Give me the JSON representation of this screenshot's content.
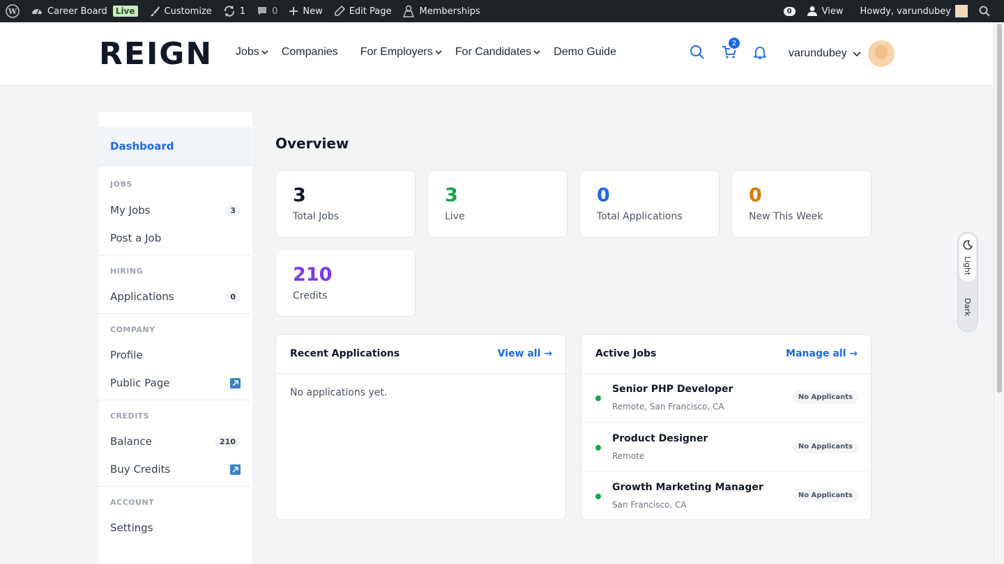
{
  "admin_bar": {
    "site_name": "Career Board",
    "live_badge": "Live",
    "customize": "Customize",
    "updates_count": "1",
    "comments_count": "0",
    "new": "New",
    "edit_page": "Edit Page",
    "memberships": "Memberships",
    "notifications_count": "0",
    "view": "View",
    "howdy": "Howdy, varundubey"
  },
  "header": {
    "logo": "REIGN",
    "nav": [
      {
        "label": "Jobs",
        "has_dropdown": true
      },
      {
        "label": "Companies",
        "has_dropdown": false
      },
      {
        "label": "For Employers",
        "has_dropdown": true
      },
      {
        "label": "For Candidates",
        "has_dropdown": true
      },
      {
        "label": "Demo Guide",
        "has_dropdown": false
      }
    ],
    "cart_count": "2",
    "username": "varundubey"
  },
  "sidebar": {
    "dashboard": "Dashboard",
    "sections": [
      {
        "heading": "JOBS",
        "items": [
          {
            "label": "My Jobs",
            "count": "3"
          },
          {
            "label": "Post a Job"
          }
        ]
      },
      {
        "heading": "HIRING",
        "items": [
          {
            "label": "Applications",
            "count": "0"
          }
        ]
      },
      {
        "heading": "COMPANY",
        "items": [
          {
            "label": "Profile"
          },
          {
            "label": "Public Page",
            "external": true
          }
        ]
      },
      {
        "heading": "CREDITS",
        "items": [
          {
            "label": "Balance",
            "count": "210"
          },
          {
            "label": "Buy Credits",
            "external": true
          }
        ]
      },
      {
        "heading": "ACCOUNT",
        "items": [
          {
            "label": "Settings"
          }
        ]
      }
    ]
  },
  "main": {
    "title": "Overview",
    "stats": [
      {
        "value": "3",
        "label": "Total Jobs",
        "color": "#111827"
      },
      {
        "value": "3",
        "label": "Live",
        "color": "#16a34a"
      },
      {
        "value": "0",
        "label": "Total Applications",
        "color": "#1d6ae5"
      },
      {
        "value": "0",
        "label": "New This Week",
        "color": "#d97706"
      },
      {
        "value": "210",
        "label": "Credits",
        "color": "#7c3aed"
      }
    ],
    "recent_applications": {
      "title": "Recent Applications",
      "link": "View all →",
      "empty": "No applications yet."
    },
    "active_jobs": {
      "title": "Active Jobs",
      "link": "Manage all →",
      "jobs": [
        {
          "title": "Senior PHP Developer",
          "location": "Remote, San Francisco, CA",
          "status": "No Applicants"
        },
        {
          "title": "Product Designer",
          "location": "Remote",
          "status": "No Applicants"
        },
        {
          "title": "Growth Marketing Manager",
          "location": "San Francisco, CA",
          "status": "No Applicants"
        }
      ]
    }
  },
  "theme_toggle": {
    "light": "Light",
    "dark": "Dark"
  },
  "colors": {
    "accent": "#1d6ae5",
    "live_dot": "#16a34a"
  }
}
